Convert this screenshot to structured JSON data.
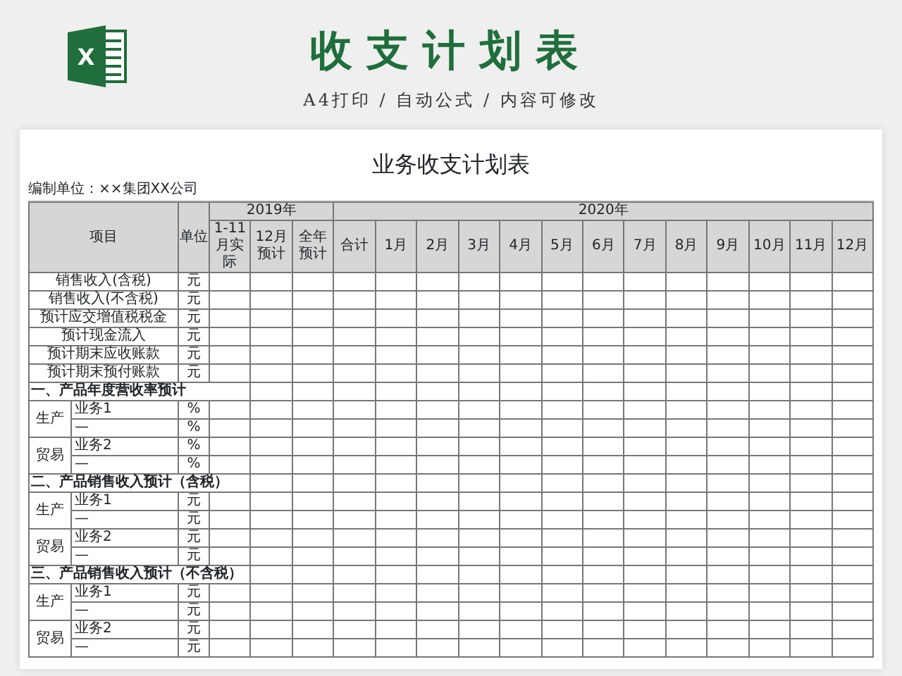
{
  "header": {
    "logo_letter": "X",
    "title": "收支计划表",
    "subtitle": "A4打印 / 自动公式 / 内容可修改"
  },
  "sheet": {
    "title": "业务收支计划表",
    "org": "编制单位：××集团XX公司",
    "columns": {
      "item": "项目",
      "unit": "单位",
      "groups": [
        {
          "label": "2019年",
          "columns": [
            "1-11月实际",
            "12月预计",
            "全年预计"
          ]
        },
        {
          "label": "2020年",
          "columns": [
            "合计",
            "1月",
            "2月",
            "3月",
            "4月",
            "5月",
            "6月",
            "7月",
            "8月",
            "9月",
            "10月",
            "11月",
            "12月"
          ]
        }
      ]
    },
    "rows": [
      {
        "kind": "item",
        "label": "销售收入(含税)",
        "unit": "元"
      },
      {
        "kind": "item",
        "label": "销售收入(不含税)",
        "unit": "元"
      },
      {
        "kind": "item",
        "label": "预计应交增值税税金",
        "unit": "元"
      },
      {
        "kind": "item",
        "label": "预计现金流入",
        "unit": "元"
      },
      {
        "kind": "item",
        "label": "预计期末应收账款",
        "unit": "元"
      },
      {
        "kind": "item",
        "label": "预计期末预付账款",
        "unit": "元"
      },
      {
        "kind": "section",
        "label": "一、产品年度营收率预计"
      },
      {
        "kind": "sub",
        "category": "生产",
        "label": "业务1",
        "unit": "%"
      },
      {
        "kind": "sub",
        "label": "—",
        "unit": "%"
      },
      {
        "kind": "sub",
        "category": "贸易",
        "label": "业务2",
        "unit": "%"
      },
      {
        "kind": "sub",
        "label": "—",
        "unit": "%"
      },
      {
        "kind": "section",
        "label": "二、产品销售收入预计（含税）"
      },
      {
        "kind": "sub",
        "category": "生产",
        "label": "业务1",
        "unit": "元"
      },
      {
        "kind": "sub",
        "label": "—",
        "unit": "元"
      },
      {
        "kind": "sub",
        "category": "贸易",
        "label": "业务2",
        "unit": "元"
      },
      {
        "kind": "sub",
        "label": "—",
        "unit": "元"
      },
      {
        "kind": "section",
        "label": "三、产品销售收入预计（不含税）"
      },
      {
        "kind": "sub",
        "category": "生产",
        "label": "业务1",
        "unit": "元"
      },
      {
        "kind": "sub",
        "label": "—",
        "unit": "元"
      },
      {
        "kind": "sub",
        "category": "贸易",
        "label": "业务2",
        "unit": "元"
      },
      {
        "kind": "sub",
        "label": "—",
        "unit": "元"
      }
    ]
  }
}
